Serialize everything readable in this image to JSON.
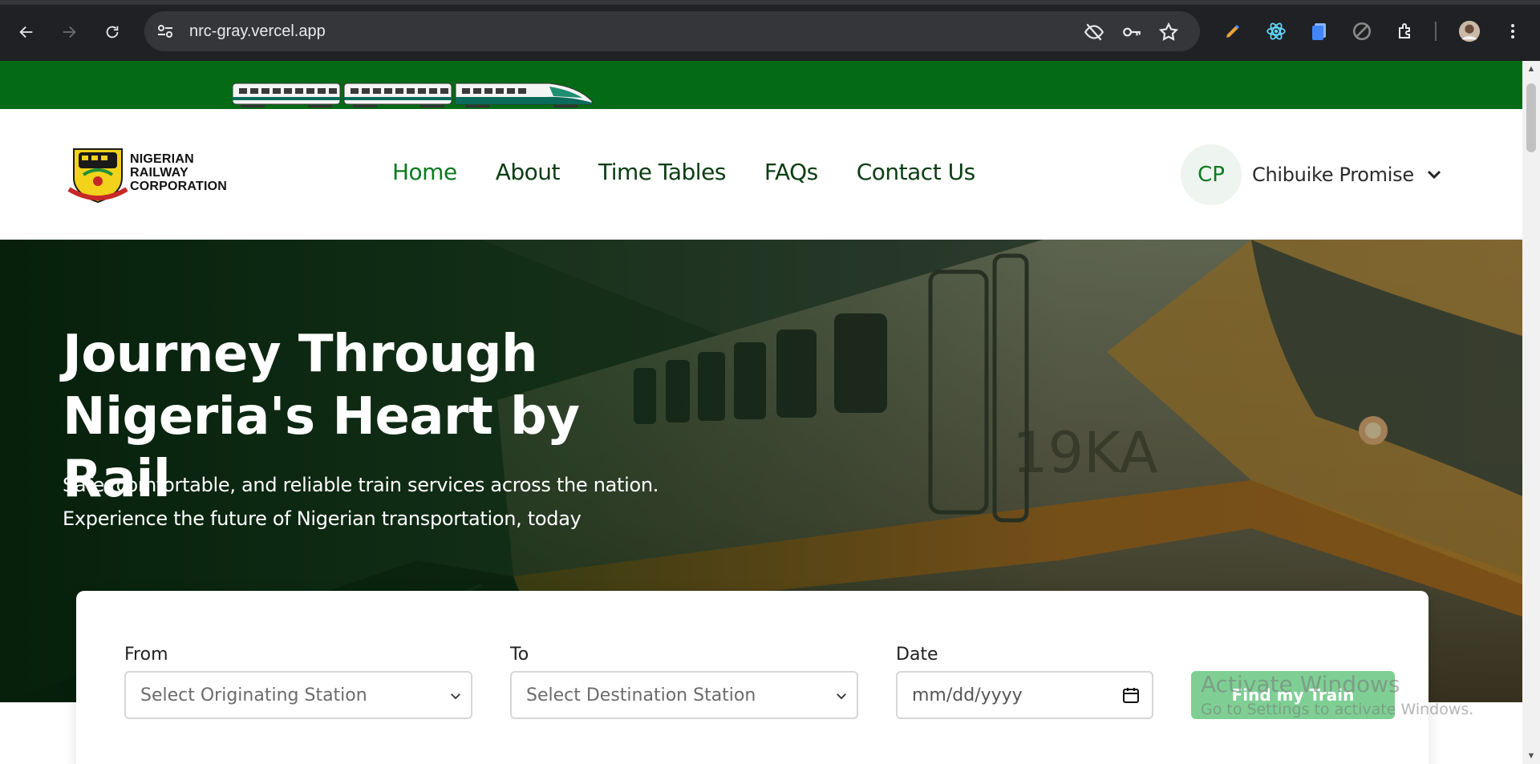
{
  "browser": {
    "url": "nrc-gray.vercel.app",
    "icons": [
      "back-icon",
      "forward-icon",
      "reload-icon",
      "site-settings-icon",
      "eye-off-icon",
      "key-icon",
      "star-icon",
      "pen-extension-icon",
      "react-extension-icon",
      "docs-extension-icon",
      "blocked-extension-icon",
      "puzzle-extension-icon",
      "profile-avatar-icon",
      "menu-kebab-icon"
    ]
  },
  "site": {
    "logo": {
      "line1": "NIGERIAN",
      "line2": "RAILWAY",
      "line3": "CORPORATION"
    },
    "nav": [
      {
        "label": "Home",
        "active": true
      },
      {
        "label": "About",
        "active": false
      },
      {
        "label": "Time Tables",
        "active": false
      },
      {
        "label": "FAQs",
        "active": false
      },
      {
        "label": "Contact Us",
        "active": false
      }
    ],
    "user": {
      "initials": "CP",
      "name": "Chibuike Promise"
    }
  },
  "hero": {
    "title_line1": "Journey Through",
    "title_line2": "Nigeria's Heart by Rail",
    "subtitle_line1": "Safe, comfortable, and reliable train services across the nation.",
    "subtitle_line2": "Experience the future of Nigerian transportation, today"
  },
  "search": {
    "from_label": "From",
    "from_placeholder": "Select Originating Station",
    "to_label": "To",
    "to_placeholder": "Select Destination Station",
    "date_label": "Date",
    "date_placeholder": "mm/dd/yyyy",
    "button_label": "Find my Train"
  },
  "watermark": {
    "title": "Activate Windows",
    "subtitle": "Go to Settings to activate Windows."
  },
  "colors": {
    "brand_green": "#046a15",
    "nav_active": "#0a7a1e",
    "button_green": "#7fcf95",
    "chrome_bg": "#202124"
  }
}
